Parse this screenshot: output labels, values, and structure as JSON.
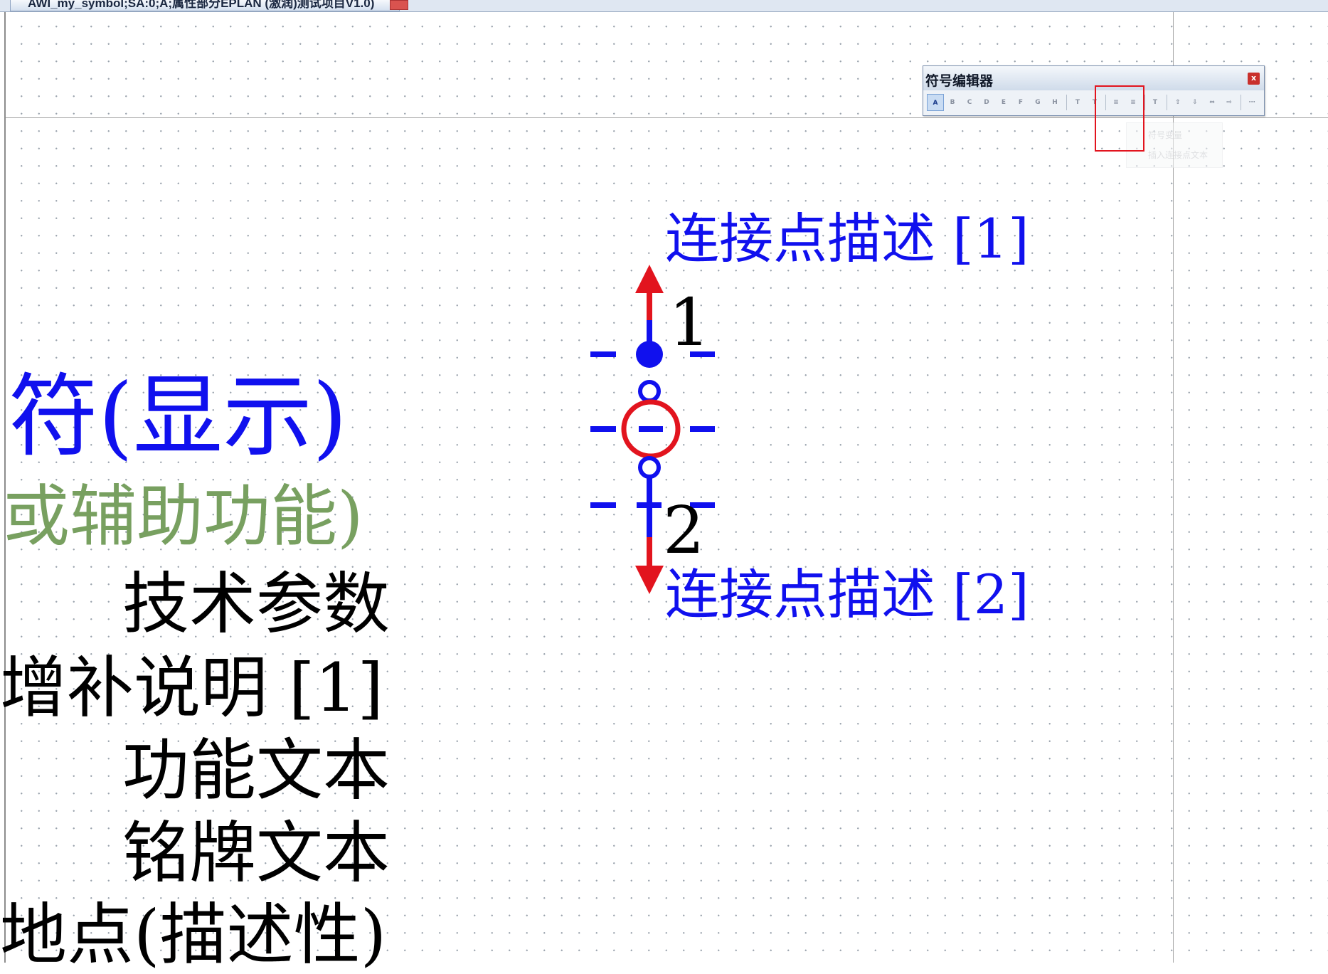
{
  "window": {
    "tab_title": "AWI_my_symbol;SA:0;A;属性部分EPLAN (激润)测试项目V1.0)"
  },
  "canvas": {
    "labels": {
      "display": "符(显示)",
      "aux": "或辅助功能)",
      "tech_params": "技术参数",
      "supplement": "增补说明 [1]",
      "function_text": "功能文本",
      "nameplate_text": "铭牌文本",
      "location": "地点(描述性)"
    },
    "connection_descriptions": [
      "连接点描述 [1]",
      "连接点描述 [2]"
    ],
    "connection_numbers": [
      "1",
      "2"
    ]
  },
  "symbol_toolbar": {
    "title": "符号编辑器",
    "close_label": "x",
    "buttons": [
      {
        "name": "connection-a",
        "label": "A"
      },
      {
        "name": "connection-b",
        "label": "B"
      },
      {
        "name": "connection-c",
        "label": "C"
      },
      {
        "name": "connection-d",
        "label": "D"
      },
      {
        "name": "connection-e",
        "label": "E"
      },
      {
        "name": "connection-f",
        "label": "F"
      },
      {
        "name": "connection-g",
        "label": "G"
      },
      {
        "name": "connection-h",
        "label": "H"
      },
      {
        "name": "text-vertical",
        "label": "T"
      },
      {
        "name": "text-slant",
        "label": "T"
      },
      {
        "name": "insert-connection",
        "label": "≡"
      },
      {
        "name": "delete-connection",
        "label": "≡"
      },
      {
        "name": "symbol-text",
        "label": "T"
      },
      {
        "name": "align-up",
        "label": "⇧"
      },
      {
        "name": "align-down",
        "label": "⇩"
      },
      {
        "name": "align-horizontal",
        "label": "⇔"
      },
      {
        "name": "align-right",
        "label": "⇨"
      },
      {
        "name": "more",
        "label": "⋯"
      }
    ],
    "ghost_menu": [
      "符号变量",
      "插入连接点文本"
    ]
  },
  "colors": {
    "connection_blue": "#1010ee",
    "connection_red": "#e2141e",
    "aux_green": "#78a060"
  }
}
